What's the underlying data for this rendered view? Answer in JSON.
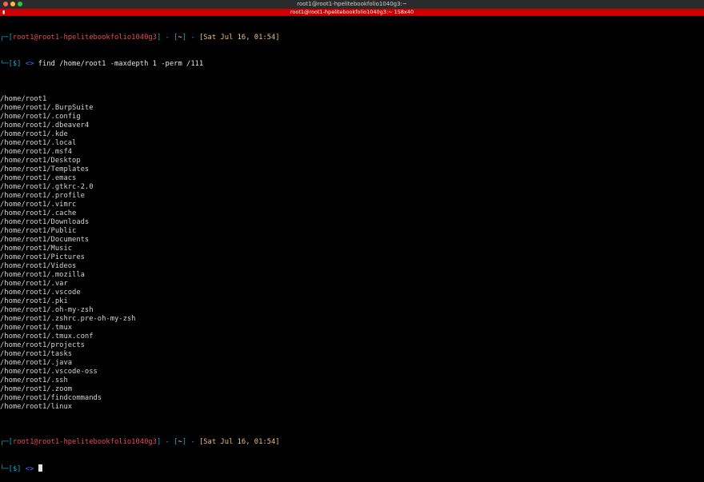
{
  "window": {
    "title": "root1@root1-hpelitebookfolio1040g3:~",
    "tab_label": "root1@root1-hpelitebookfolio1040g3:~ 158x40"
  },
  "prompt1": {
    "corner": "┌─",
    "user_open": "[",
    "userhost": "root1@root1-hpelitebookfolio1040g3",
    "user_close": "]",
    "sep1": " - ",
    "dir_open": "[",
    "dir": "~",
    "dir_close": "]",
    "sep2": " - ",
    "date": "[Sat Jul 16, 01:54]",
    "corner2": "└─",
    "dollar": "[$]",
    "arrow": " <> ",
    "command": "find /home/root1 -maxdepth 1 -perm /111"
  },
  "output": [
    "/home/root1",
    "/home/root1/.BurpSuite",
    "/home/root1/.config",
    "/home/root1/.dbeaver4",
    "/home/root1/.kde",
    "/home/root1/.local",
    "/home/root1/.msf4",
    "/home/root1/Desktop",
    "/home/root1/Templates",
    "/home/root1/.emacs",
    "/home/root1/.gtkrc-2.0",
    "/home/root1/.profile",
    "/home/root1/.vimrc",
    "/home/root1/.cache",
    "/home/root1/Downloads",
    "/home/root1/Public",
    "/home/root1/Documents",
    "/home/root1/Music",
    "/home/root1/Pictures",
    "/home/root1/Videos",
    "/home/root1/.mozilla",
    "/home/root1/.var",
    "/home/root1/.vscode",
    "/home/root1/.pki",
    "/home/root1/.oh-my-zsh",
    "/home/root1/.zshrc.pre-oh-my-zsh",
    "/home/root1/.tmux",
    "/home/root1/.tmux.conf",
    "/home/root1/projects",
    "/home/root1/tasks",
    "/home/root1/.java",
    "/home/root1/.vscode-oss",
    "/home/root1/.ssh",
    "/home/root1/.zoom",
    "/home/root1/findcommands",
    "/home/root1/linux"
  ],
  "prompt2": {
    "corner": "┌─",
    "user_open": "[",
    "userhost": "root1@root1-hpelitebookfolio1040g3",
    "user_close": "]",
    "sep1": " - ",
    "dir_open": "[",
    "dir": "~",
    "dir_close": "]",
    "sep2": " - ",
    "date": "[Sat Jul 16, 01:54]",
    "corner2": "└─",
    "dollar": "[$]",
    "arrow": " <> "
  },
  "colors": {
    "titlebar": "#2b2b2b",
    "tabbar": "#cc0000",
    "prompt_bracket": "#11a8cd",
    "prompt_user": "#e74856",
    "prompt_date": "#e5c07b"
  }
}
